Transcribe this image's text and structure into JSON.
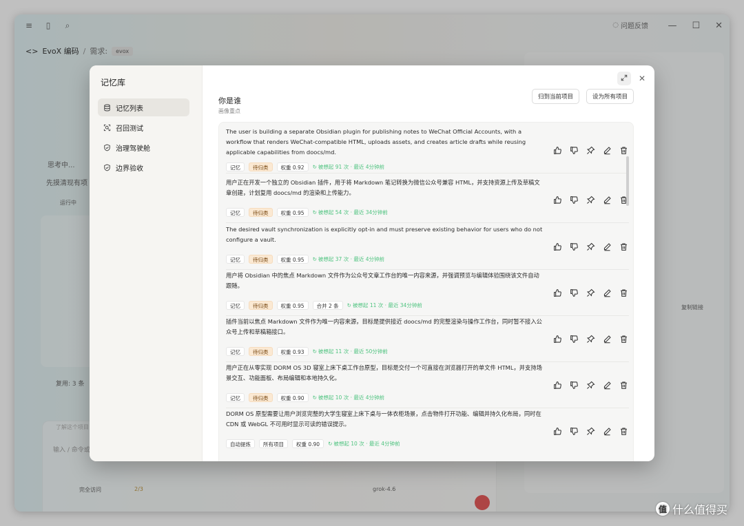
{
  "app": {
    "titlebar": {
      "feedback_label": "问题反馈",
      "minimize": "—",
      "maximize": "☐",
      "close": "✕"
    },
    "breadcrumb": {
      "project": "EvoX 编码",
      "separator": "/",
      "section": "需求:",
      "tag": "evox"
    },
    "background": {
      "thinking": "思考中...",
      "clarify": "先摸清现有项",
      "running": "运行中",
      "reuse": "复用: 3 条",
      "understand": "了解这个项目",
      "input_placeholder": "输入 / 命令或",
      "access": "完全访问",
      "counter": "2/3",
      "model": "grok-4.6",
      "copy_link": "复制链接"
    }
  },
  "modal": {
    "title": "记忆库",
    "nav": [
      {
        "label": "记忆列表",
        "icon": "database-icon",
        "active": true
      },
      {
        "label": "召回测试",
        "icon": "search-square-icon",
        "active": false
      },
      {
        "label": "治理驾驶舱",
        "icon": "shield-check-icon",
        "active": false
      },
      {
        "label": "边界验收",
        "icon": "shield-check-icon",
        "active": false
      }
    ],
    "header": {
      "title": "你是谁",
      "subtitle": "画像重点",
      "btn_project": "归到当前项目",
      "btn_all": "设为所有项目",
      "expand_icon": "expand-icon",
      "close_icon": "close-icon"
    },
    "memories": [
      {
        "text": "The user is building a separate Obsidian plugin for publishing notes to WeChat Official Accounts, with a workflow that renders WeChat-compatible HTML, uploads assets, and creates article drafts while reusing applicable capabilities from doocs/md.",
        "tags": [
          "记忆",
          "待归类",
          "权重 0.92"
        ],
        "recall": "被想起 91 次 · 最近 4分钟前"
      },
      {
        "text": "用户正在开发一个独立的 Obsidian 插件，用于将 Markdown 笔记转换为微信公众号兼容 HTML，并支持资源上传及草稿文章创建，计划复用 doocs/md 的渲染和上传能力。",
        "tags": [
          "记忆",
          "待归类",
          "权重 0.95"
        ],
        "recall": "被想起 54 次 · 最近 34分钟前"
      },
      {
        "text": "The desired vault synchronization is explicitly opt-in and must preserve existing behavior for users who do not configure a vault.",
        "tags": [
          "记忆",
          "待归类",
          "权重 0.95"
        ],
        "recall": "被想起 37 次 · 最近 4分钟前"
      },
      {
        "text": "用户将 Obsidian 中的焦点 Markdown 文件作为公众号文章工作台的唯一内容来源，并强调预览与编辑体验围绕该文件自动跟随。",
        "tags": [
          "记忆",
          "待归类",
          "权重 0.95",
          "合并 2 条"
        ],
        "recall": "被想起 11 次 · 最近 34分钟前"
      },
      {
        "text": "插件当前以焦点 Markdown 文件作为唯一内容来源，目标是提供接近 doocs/md 的完整渲染与操作工作台，同时暂不接入公众号上传和草稿箱接口。",
        "tags": [
          "记忆",
          "待归类",
          "权重 0.93"
        ],
        "recall": "被想起 11 次 · 最近 50分钟前"
      },
      {
        "text": "用户正在从零实现 DORM OS 3D 寝室上床下桌工作台原型，目标是交付一个可直接在浏览器打开的单文件 HTML，并支持场景交互、功能面板、布局编辑和本地持久化。",
        "tags": [
          "记忆",
          "待归类",
          "权重 0.90"
        ],
        "recall": "被想起 10 次 · 最近 4分钟前"
      },
      {
        "text": "DORM OS 原型需要让用户浏览完整的大学生寝室上床下桌与一体衣柜场景，点击物件打开功能、编辑并持久化布局，同时在 CDN 或 WebGL 不可用时显示可读的错误提示。",
        "tags": [
          "自动提炼",
          "所有项目",
          "权重 0.90"
        ],
        "recall": "被想起 10 次 · 最近 4分钟前"
      }
    ]
  },
  "watermark": {
    "logo": "值",
    "text": "什么值得买"
  },
  "colors": {
    "accent_green": "#4ec37f",
    "pending_tag_bg": "#fbe9d3",
    "send_button": "#e34a4a"
  }
}
